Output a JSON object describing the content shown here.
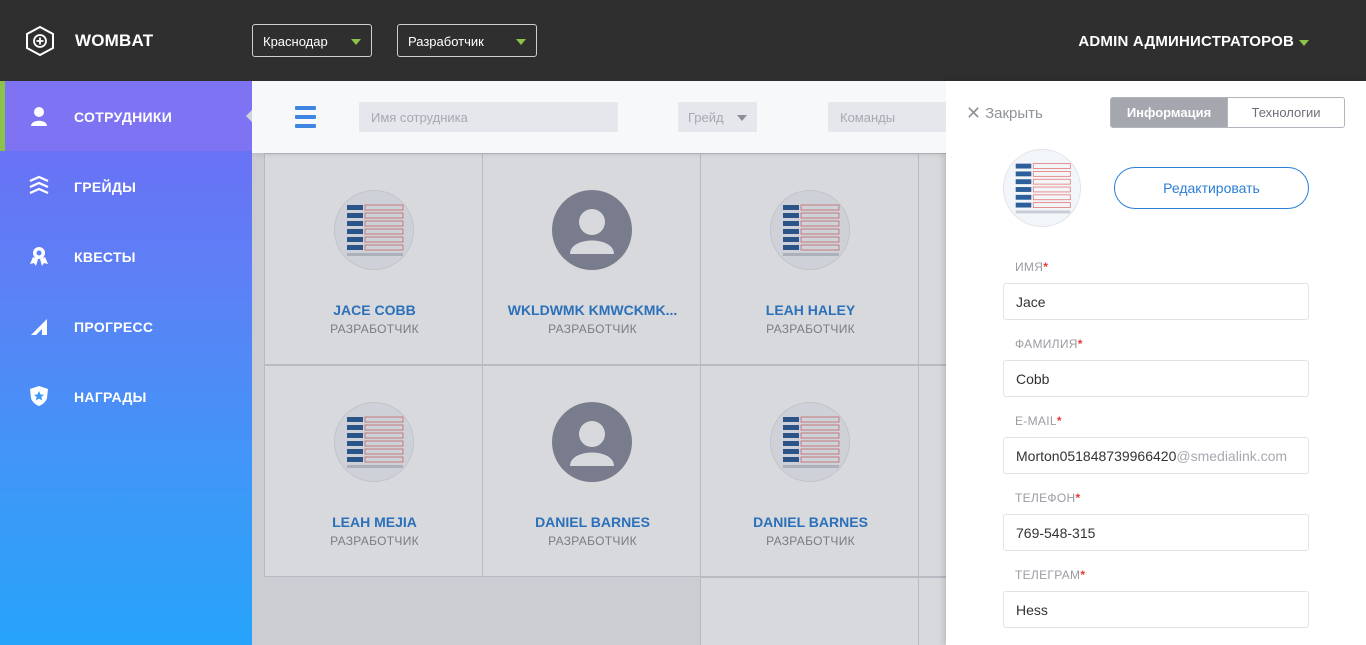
{
  "app": {
    "brand": "WOMBAT",
    "user": "ADMIN АДМИНИСТРАТОРОВ"
  },
  "topbar": {
    "city_select": "Краснодар",
    "role_select": "Разработчик"
  },
  "sidebar": {
    "items": [
      {
        "label": "СОТРУДНИКИ",
        "icon": "person-icon",
        "active": true
      },
      {
        "label": "ГРЕЙДЫ",
        "icon": "layers-icon"
      },
      {
        "label": "КВЕСТЫ",
        "icon": "award-icon"
      },
      {
        "label": "ПРОГРЕСС",
        "icon": "signal-icon"
      },
      {
        "label": "НАГРАДЫ",
        "icon": "shield-star-icon"
      }
    ]
  },
  "toolbar": {
    "search_placeholder": "Имя сотрудника",
    "grade_placeholder": "Грейд",
    "teams_placeholder": "Команды"
  },
  "employees": [
    {
      "name": "JACE COBB",
      "role": "РАЗРАБОТЧИК",
      "avatar": "screenshot"
    },
    {
      "name": "WKLDWMK KMWCKMK...",
      "role": "РАЗРАБОТЧИК",
      "avatar": "placeholder"
    },
    {
      "name": "LEAH HALEY",
      "role": "РАЗРАБОТЧИК",
      "avatar": "screenshot"
    },
    {
      "name": "LEAH MEJIA",
      "role": "РАЗРАБОТЧИК",
      "avatar": "screenshot"
    },
    {
      "name": "DANIEL BARNES",
      "role": "РАЗРАБОТЧИК",
      "avatar": "placeholder"
    },
    {
      "name": "DANIEL BARNES",
      "role": "РАЗРАБОТЧИК",
      "avatar": "screenshot"
    }
  ],
  "panel": {
    "close_label": "Закрыть",
    "tab_info": "Информация",
    "tab_tech": "Технологии",
    "edit_button": "Редактировать",
    "fields": {
      "first_name": {
        "label": "ИМЯ",
        "value": "Jace"
      },
      "last_name": {
        "label": "ФАМИЛИЯ",
        "value": "Cobb"
      },
      "email": {
        "label": "E-MAIL",
        "value": "Morton051848739966420",
        "domain": "@smedialink.com"
      },
      "phone": {
        "label": "ТЕЛЕФОН",
        "value": "769-548-315"
      },
      "telegram": {
        "label": "ТЕЛЕГРАМ",
        "value": "Hess"
      }
    }
  },
  "colors": {
    "accent": "#2c7fd6",
    "active_bar": "#8bc34a",
    "required": "#e53935",
    "topbar": "#2f2f2f"
  }
}
